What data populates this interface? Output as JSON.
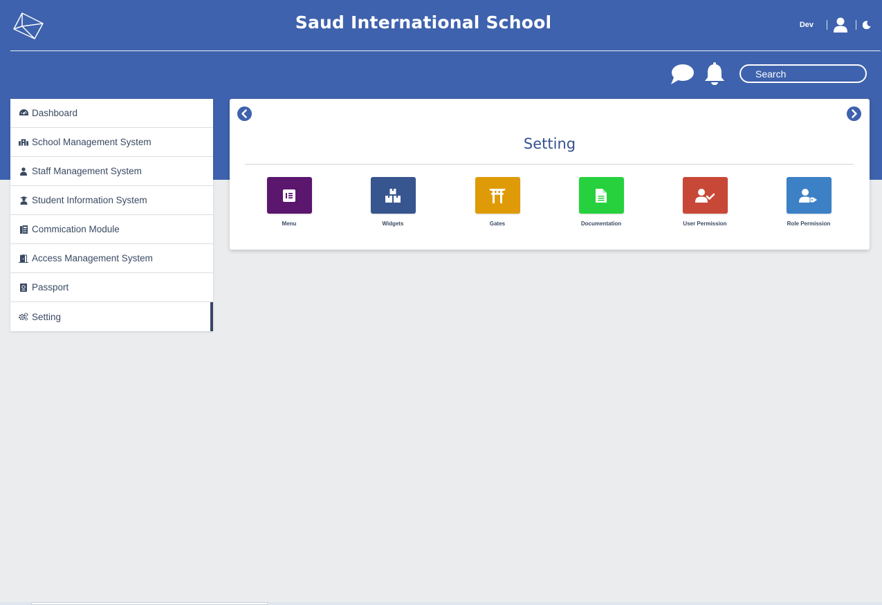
{
  "header": {
    "title": "Saud International School",
    "user_name": "Dev",
    "search_placeholder": "Search"
  },
  "sidebar": {
    "items": [
      {
        "label": "Dashboard",
        "icon": "dashboard-icon"
      },
      {
        "label": "School Management System",
        "icon": "school-icon"
      },
      {
        "label": "Staff Management System",
        "icon": "staff-icon"
      },
      {
        "label": "Student Information System",
        "icon": "student-icon"
      },
      {
        "label": "Commication Module",
        "icon": "communication-icon"
      },
      {
        "label": "Access Management System",
        "icon": "access-icon"
      },
      {
        "label": "Passport",
        "icon": "passport-icon"
      },
      {
        "label": "Setting",
        "icon": "gears-icon",
        "active": true
      }
    ]
  },
  "main": {
    "title": "Setting",
    "tiles": [
      {
        "label": "Menu",
        "color": "#5b166e",
        "icon": "menu-icon"
      },
      {
        "label": "Widgets",
        "color": "#37558f",
        "icon": "widgets-icon"
      },
      {
        "label": "Gates",
        "color": "#de9b07",
        "icon": "gate-icon"
      },
      {
        "label": "Documentation",
        "color": "#27d13e",
        "icon": "document-icon"
      },
      {
        "label": "User Permission",
        "color": "#c84837",
        "icon": "user-check-icon"
      },
      {
        "label": "Role Permission",
        "color": "#3c80c6",
        "icon": "user-tag-icon"
      }
    ]
  },
  "colors": {
    "primary": "#3e62ad",
    "background": "#ebecee",
    "sidebar_active_bar": "#37456a"
  }
}
